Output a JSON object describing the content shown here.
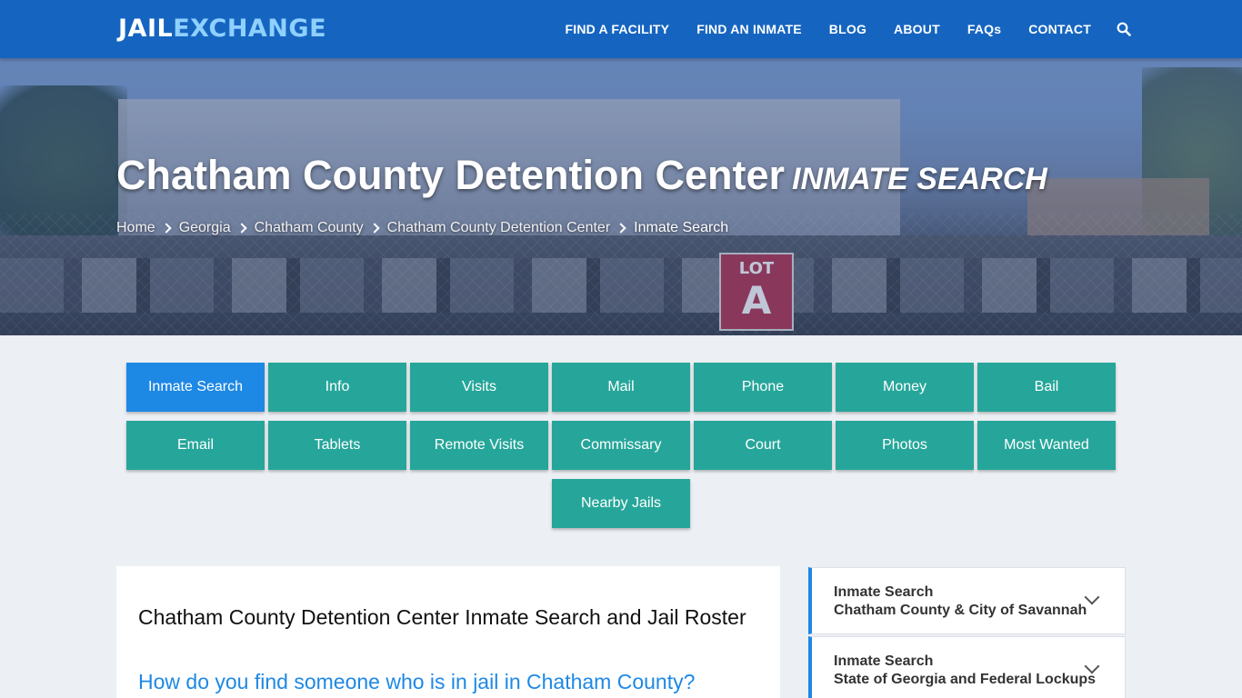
{
  "header": {
    "logo_part1": "JAIL",
    "logo_part2": "EXCHANGE",
    "nav": [
      "FIND A FACILITY",
      "FIND AN INMATE",
      "BLOG",
      "ABOUT",
      "FAQs",
      "CONTACT"
    ]
  },
  "hero": {
    "title": "Chatham County Detention Center",
    "subtitle": "INMATE SEARCH",
    "sign_line1": "LOT",
    "sign_line2": "A",
    "breadcrumbs": [
      "Home",
      "Georgia",
      "Chatham County",
      "Chatham County Detention Center"
    ],
    "breadcrumb_current": "Inmate Search"
  },
  "buttons": {
    "row1": [
      "Inmate Search",
      "Info",
      "Visits",
      "Mail",
      "Phone",
      "Money",
      "Bail"
    ],
    "row2": [
      "Email",
      "Tablets",
      "Remote Visits",
      "Commissary",
      "Court",
      "Photos",
      "Most Wanted"
    ],
    "row3": [
      "Nearby Jails"
    ],
    "active": "Inmate Search"
  },
  "main": {
    "heading": "Chatham County Detention Center Inmate Search and Jail Roster",
    "subheading": "How do you find someone who is in jail in Chatham County?"
  },
  "sidebar": {
    "items": [
      {
        "line1": "Inmate Search",
        "line2": "Chatham County & City of Savannah"
      },
      {
        "line1": "Inmate Search",
        "line2": "State of Georgia and Federal Lockups"
      }
    ]
  },
  "colors": {
    "header_bg": "#1565c0",
    "logo_accent": "#8fd0ff",
    "button_teal": "#26a69a",
    "button_active": "#1e88e5",
    "link_blue": "#1e88e5"
  }
}
